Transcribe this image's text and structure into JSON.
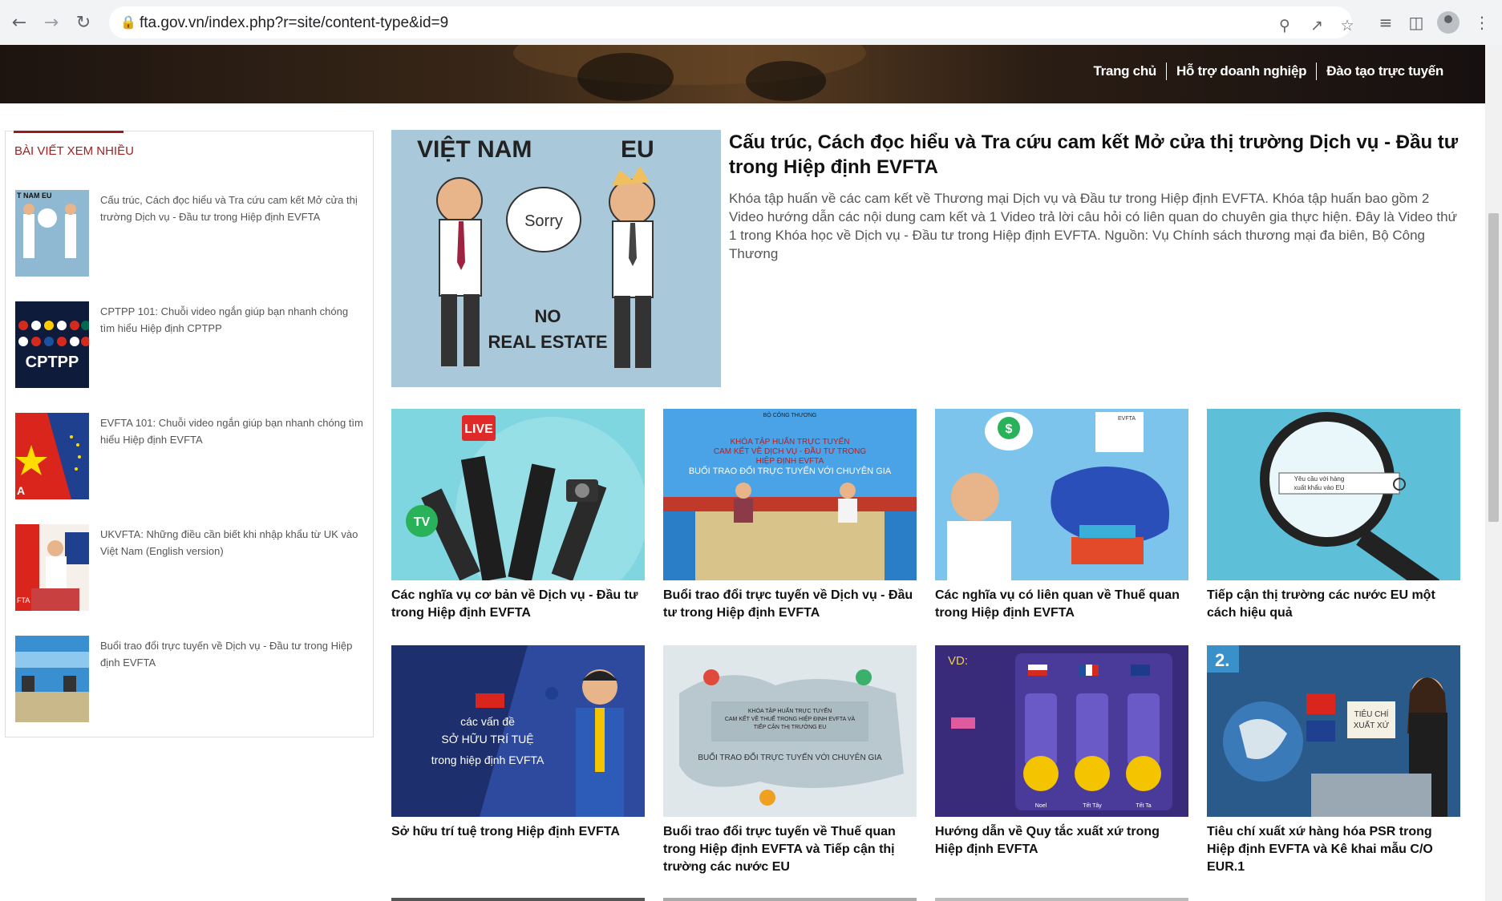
{
  "browser": {
    "url": "fta.gov.vn/index.php?r=site/content-type&id=9"
  },
  "site_nav": [
    "Trang chủ",
    "Hỗ trợ doanh nghiệp",
    "Đào tạo trực tuyến"
  ],
  "sidebar": {
    "title": "BÀI VIẾT XEM NHIỀU",
    "items": [
      {
        "label": "Cấu trúc, Cách đọc hiểu và Tra cứu cam kết Mở cửa thị trường Dịch vụ - Đầu tư trong Hiệp định EVFTA",
        "thumb_text": "T NAM        EU"
      },
      {
        "label": "CPTPP 101: Chuỗi video ngắn giúp bạn nhanh chóng tìm hiểu Hiệp định CPTPP",
        "thumb_text": "CPTPP"
      },
      {
        "label": "EVFTA 101: Chuỗi video ngắn giúp bạn nhanh chóng tìm hiểu Hiệp định EVFTA",
        "thumb_text": "A"
      },
      {
        "label": "UKVFTA: Những điều cần biết khi nhập khẩu từ UK vào Việt Nam (English version)",
        "thumb_text": "FTA"
      },
      {
        "label": "Buổi trao đổi trực tuyến về Dịch vụ - Đầu tư trong Hiệp định EVFTA",
        "thumb_text": ""
      }
    ]
  },
  "featured": {
    "title": "Cấu trúc, Cách đọc hiểu và Tra cứu cam kết Mở cửa thị trường Dịch vụ - Đầu tư trong Hiệp định EVFTA",
    "description": "Khóa tập huấn về các cam kết về Thương mại Dịch vụ và Đầu tư trong Hiệp định EVFTA. Khóa tập huấn bao gồm 2 Video hướng dẫn các nội dung cam kết và 1 Video trả lời câu hỏi có liên quan do chuyên gia thực hiện. Đây là Video thứ 1 trong Khóa học về Dịch vụ - Đầu tư trong Hiệp định EVFTA. Nguồn: Vụ Chính sách thương mại đa biên, Bộ Công Thương",
    "image_text": {
      "left": "VIỆT NAM",
      "right": "EU",
      "bubble": "Sorry",
      "sign1": "NO",
      "sign2": "REAL ESTATE"
    }
  },
  "cards": [
    {
      "title": "Các nghĩa vụ cơ bản về Dịch vụ - Đầu tư trong Hiệp định EVFTA",
      "image_text": [
        "LIVE",
        "TV"
      ]
    },
    {
      "title": "Buổi trao đổi trực tuyến về Dịch vụ - Đầu tư trong Hiệp định EVFTA",
      "image_text": [
        "BỘ CÔNG THƯƠNG",
        "KHÓA TẬP HUẤN TRỰC TUYẾN",
        "CAM KẾT VỀ DỊCH VỤ - ĐẦU TƯ TRONG",
        "HIỆP ĐỊNH EVFTA",
        "BUỔI TRAO ĐỔI TRỰC TUYẾN VỚI CHUYÊN GIA"
      ]
    },
    {
      "title": "Các nghĩa vụ có liên quan về Thuế quan trong Hiệp định EVFTA",
      "image_text": [
        "$",
        "EVFTA"
      ]
    },
    {
      "title": "Tiếp cận thị trường các nước EU một cách hiệu quả",
      "image_text": [
        "Yêu cầu với hàng",
        "xuất khẩu vào EU"
      ]
    },
    {
      "title": "Sở hữu trí tuệ trong Hiệp định EVFTA",
      "image_text": [
        "các vấn đề",
        "SỞ HỮU TRÍ TUỆ",
        "trong hiệp định EVFTA"
      ]
    },
    {
      "title": "Buổi trao đổi trực tuyến về Thuế quan trong Hiệp định EVFTA và Tiếp cận thị trường các nước EU",
      "image_text": [
        "KHÓA TẬP HUẤN TRỰC TUYẾN",
        "CAM KẾT VỀ THUẾ TRONG HIỆP ĐỊNH EVFTA VÀ",
        "TIẾP CẬN THỊ TRƯỜNG EU",
        "BUỔI TRAO ĐỔI TRỰC TUYẾN VỚI CHUYÊN GIA"
      ]
    },
    {
      "title": "Hướng dẫn về Quy tắc xuất xứ trong Hiệp định EVFTA",
      "image_text": [
        "VD:",
        "Noel",
        "Tết Tây",
        "Tết Ta"
      ]
    },
    {
      "title": "Tiêu chí xuất xứ hàng hóa PSR trong Hiệp định EVFTA và Kê khai mẫu C/O EUR.1",
      "image_text": [
        "2.",
        "TIÊU CHÍ",
        "XUẤT XỨ"
      ]
    }
  ],
  "colors": {
    "accent_red": "#a31f1f",
    "chrome_bg": "#f1f3f4"
  }
}
